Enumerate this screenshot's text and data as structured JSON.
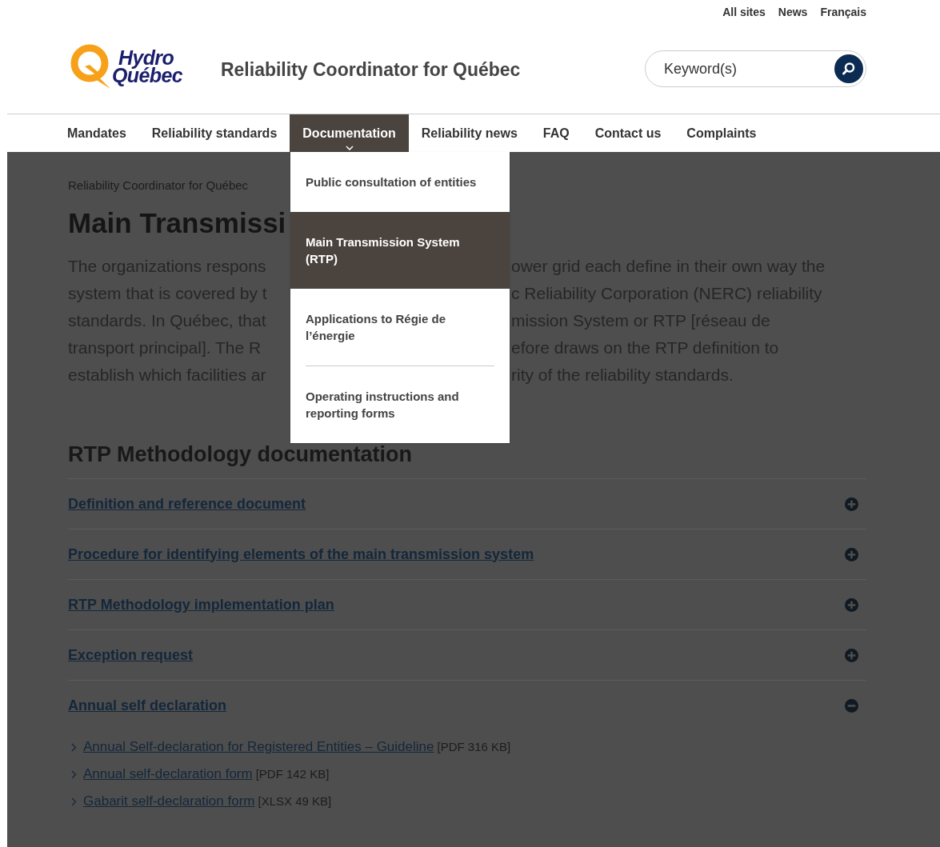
{
  "top_links": [
    "All sites",
    "News",
    "Français"
  ],
  "logo": {
    "line_1": "Hydro",
    "line_2": "Québec"
  },
  "site_title": "Reliability Coordinator for Québec",
  "search": {
    "placeholder": "Keyword(s)"
  },
  "nav": [
    {
      "label": "Mandates",
      "selected": false
    },
    {
      "label": "Reliability standards",
      "selected": false
    },
    {
      "label": "Documentation",
      "selected": true
    },
    {
      "label": "Reliability news",
      "selected": false
    },
    {
      "label": "FAQ",
      "selected": false
    },
    {
      "label": "Contact us",
      "selected": false
    },
    {
      "label": "Complaints",
      "selected": false
    }
  ],
  "dropdown": [
    {
      "label": "Public consultation of entities",
      "selected": false
    },
    {
      "label": "Main Transmission System (RTP)",
      "selected": true
    },
    {
      "label": "Applications to Régie de l’énergie",
      "selected": false
    },
    {
      "label": "Operating instructions and reporting forms",
      "selected": false
    }
  ],
  "breadcrumb": "Reliability Coordinator for Québec",
  "page_title": "Main Transmissi",
  "intro_lines": [
    {
      "left": "The organizations respons",
      "right": "ower grid each define in their own way the"
    },
    {
      "left": "system that is covered by t",
      "right": "c Reliability Corporation (NERC) reliability"
    },
    {
      "left": "standards. In Québec, that",
      "right": "mission System or RTP [réseau de"
    },
    {
      "left": "transport principal]. The R",
      "right": "efore draws on the RTP definition to"
    },
    {
      "left": "establish which facilities ar",
      "right": "rity of the reliability standards."
    }
  ],
  "section_title": "RTP Methodology documentation",
  "accordion": [
    {
      "title": "Definition and reference document",
      "expanded": false
    },
    {
      "title": "Procedure for identifying elements of the main transmission system",
      "expanded": false
    },
    {
      "title": "RTP Methodology implementation plan",
      "expanded": false
    },
    {
      "title": "Exception request",
      "expanded": false
    },
    {
      "title": "Annual self declaration",
      "expanded": true,
      "documents": [
        {
          "title": "Annual Self-declaration for Registered Entities – Guideline",
          "file": "[PDF 316 KB]"
        },
        {
          "title": "Annual self-declaration form",
          "file": "[PDF 142 KB]"
        },
        {
          "title": "Gabarit self-declaration form",
          "file": "[XLSX 49 KB]"
        }
      ]
    }
  ]
}
